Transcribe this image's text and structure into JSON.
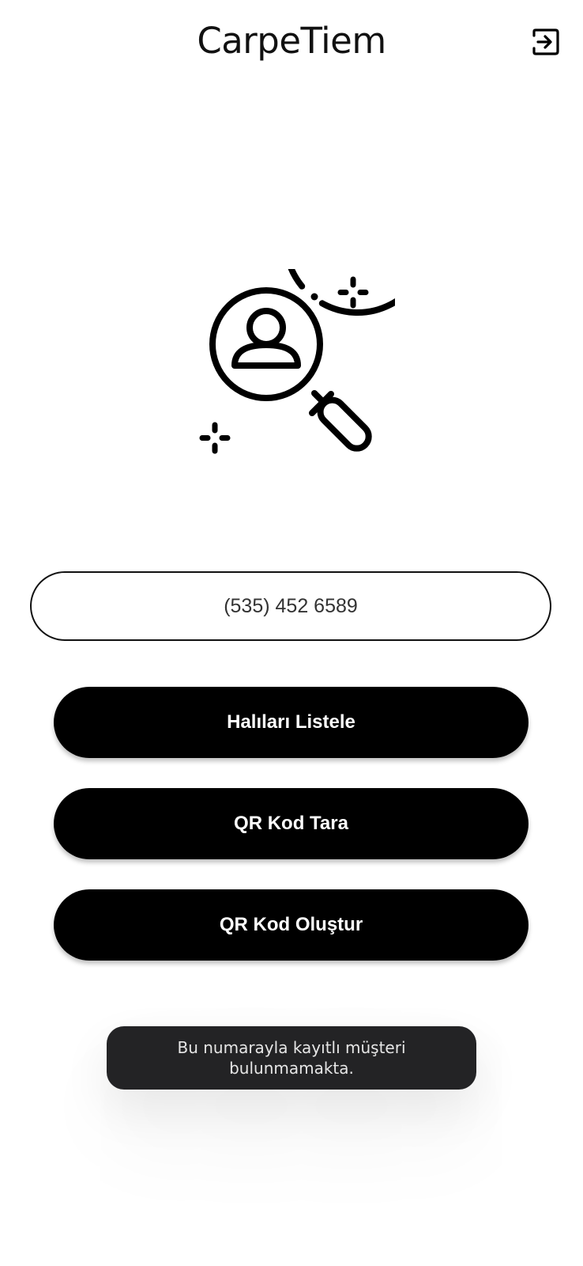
{
  "header": {
    "title": "CarpeTiem",
    "logout_icon": "logout-icon"
  },
  "hero": {
    "icon": "search-person-icon"
  },
  "phone_input": {
    "value": "(535) 452 6589"
  },
  "buttons": {
    "list_carpets": "Halıları Listele",
    "scan_qr": "QR Kod Tara",
    "create_qr": "QR Kod Oluştur"
  },
  "toast": {
    "message": "Bu numarayla kayıtlı müşteri bulunmamakta."
  },
  "colors": {
    "background": "#ffffff",
    "button": "#000000",
    "button_text": "#ffffff",
    "toast_bg": "#232325",
    "toast_text": "#e6e6e6"
  }
}
